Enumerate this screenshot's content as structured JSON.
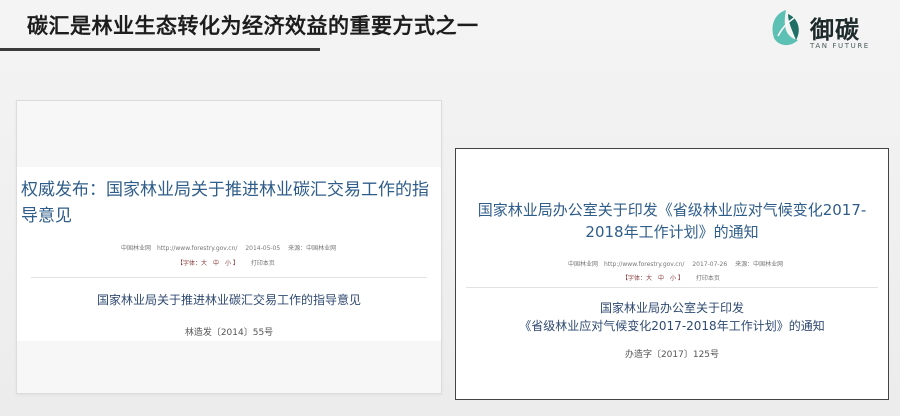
{
  "header": {
    "title": "碳汇是林业生态转化为经济效益的重要方式之一",
    "logo_cn": "御碳",
    "logo_en": "TAN FUTURE"
  },
  "left_doc": {
    "heading": "权威发布：国家林业局关于推进林业碳汇交易工作的指导意见",
    "meta": "中国林业网　http://www.forestry.gov.cn/　 2014-05-05　 来源：中国林业网",
    "controls": "【字体：大　中　小 】",
    "print": "打印本页",
    "subheading": "国家林业局关于推进林业碳汇交易工作的指导意见",
    "docno": "林造发〔2014〕55号"
  },
  "right_doc": {
    "heading_line1": "国家林业局办公室关于印发《省级林业应对气候变化2017-",
    "heading_line2": "2018年工作计划》的通知",
    "meta": "中国林业网　http://www.forestry.gov.cn/　 2017-07-26　 来源：中国林业网",
    "controls": "【字体：大　中　小 】",
    "print": "打印本页",
    "subheading_line1": "国家林业局办公室关于印发",
    "subheading_line2": "《省级林业应对气候变化2017-2018年工作计划》的通知",
    "docno": "办造字〔2017〕125号"
  },
  "colors": {
    "heading": "#2f5d8a",
    "logo_teal": "#2aa69a"
  }
}
